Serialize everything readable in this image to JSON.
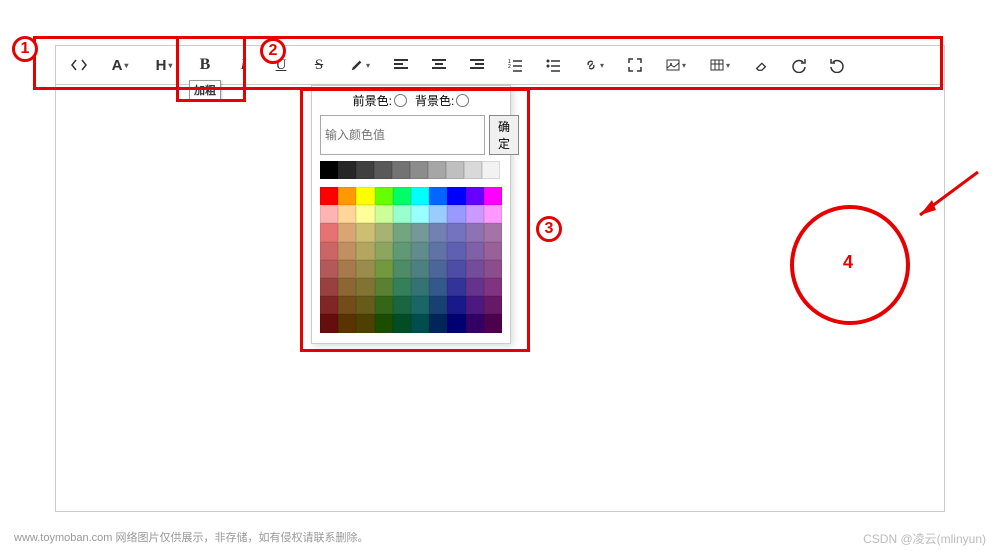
{
  "toolbar": {
    "bold_tooltip": "加粗",
    "icons": {
      "code": "code",
      "font": "A",
      "heading": "H",
      "bold": "B",
      "italic": "I",
      "underline": "U",
      "strike": "S",
      "brush": "brush",
      "align_left": "align-left",
      "align_center": "align-center",
      "align_right": "align-right",
      "list_ol": "list-ol",
      "list_ul": "list-ul",
      "link": "link",
      "maximize": "maximize",
      "image": "image",
      "table": "table",
      "eraser": "eraser",
      "redo": "redo",
      "undo": "undo"
    }
  },
  "colorpanel": {
    "fg_label": "前景色:",
    "bg_label": "背景色:",
    "input_placeholder": "输入颜色值",
    "confirm_label": "确定",
    "grays": [
      "#000000",
      "#262626",
      "#404040",
      "#595959",
      "#737373",
      "#8c8c8c",
      "#a6a6a6",
      "#bfbfbf",
      "#d9d9d9",
      "#f2f2f2"
    ],
    "palette": [
      "#ff0000",
      "#ff9900",
      "#ffff00",
      "#66ff00",
      "#00ff66",
      "#00ffff",
      "#0066ff",
      "#0000ff",
      "#6600ff",
      "#ff00ff",
      "#ffb3b3",
      "#ffd699",
      "#ffff99",
      "#ccff99",
      "#99ffcc",
      "#99ffff",
      "#99ccff",
      "#9999ff",
      "#cc99ff",
      "#ff99ff",
      "#e67373",
      "#d9a673",
      "#ccbf73",
      "#a6b373",
      "#73a680",
      "#739999",
      "#7380b3",
      "#7373bf",
      "#8c73b3",
      "#a673a6",
      "#cc6666",
      "#c09060",
      "#b3a660",
      "#8ca660",
      "#609973",
      "#608c8c",
      "#6073a6",
      "#6060b3",
      "#8060a6",
      "#996099",
      "#b35959",
      "#a67a4d",
      "#998c4d",
      "#739940",
      "#4d8c66",
      "#4d8080",
      "#4d6699",
      "#4d4da6",
      "#734d99",
      "#8c4d8c",
      "#994040",
      "#8c6633",
      "#807333",
      "#598033",
      "#338059",
      "#337373",
      "#33598c",
      "#333399",
      "#66338c",
      "#803380",
      "#802626",
      "#734d19",
      "#665c19",
      "#336619",
      "#196640",
      "#196666",
      "#194073",
      "#19198c",
      "#4d1980",
      "#661966",
      "#660d0d",
      "#593300",
      "#4d4000",
      "#1a4d00",
      "#004d26",
      "#004d4d",
      "#002659",
      "#000073",
      "#330066",
      "#4d004d"
    ]
  },
  "annotations": {
    "n1": "1",
    "n2": "2",
    "n3": "3",
    "n4": "4"
  },
  "footer": {
    "text": "www.toymoban.com 网络图片仅供展示，非存储，如有侵权请联系删除。",
    "watermark": "CSDN @凌云(mlinyun)"
  }
}
